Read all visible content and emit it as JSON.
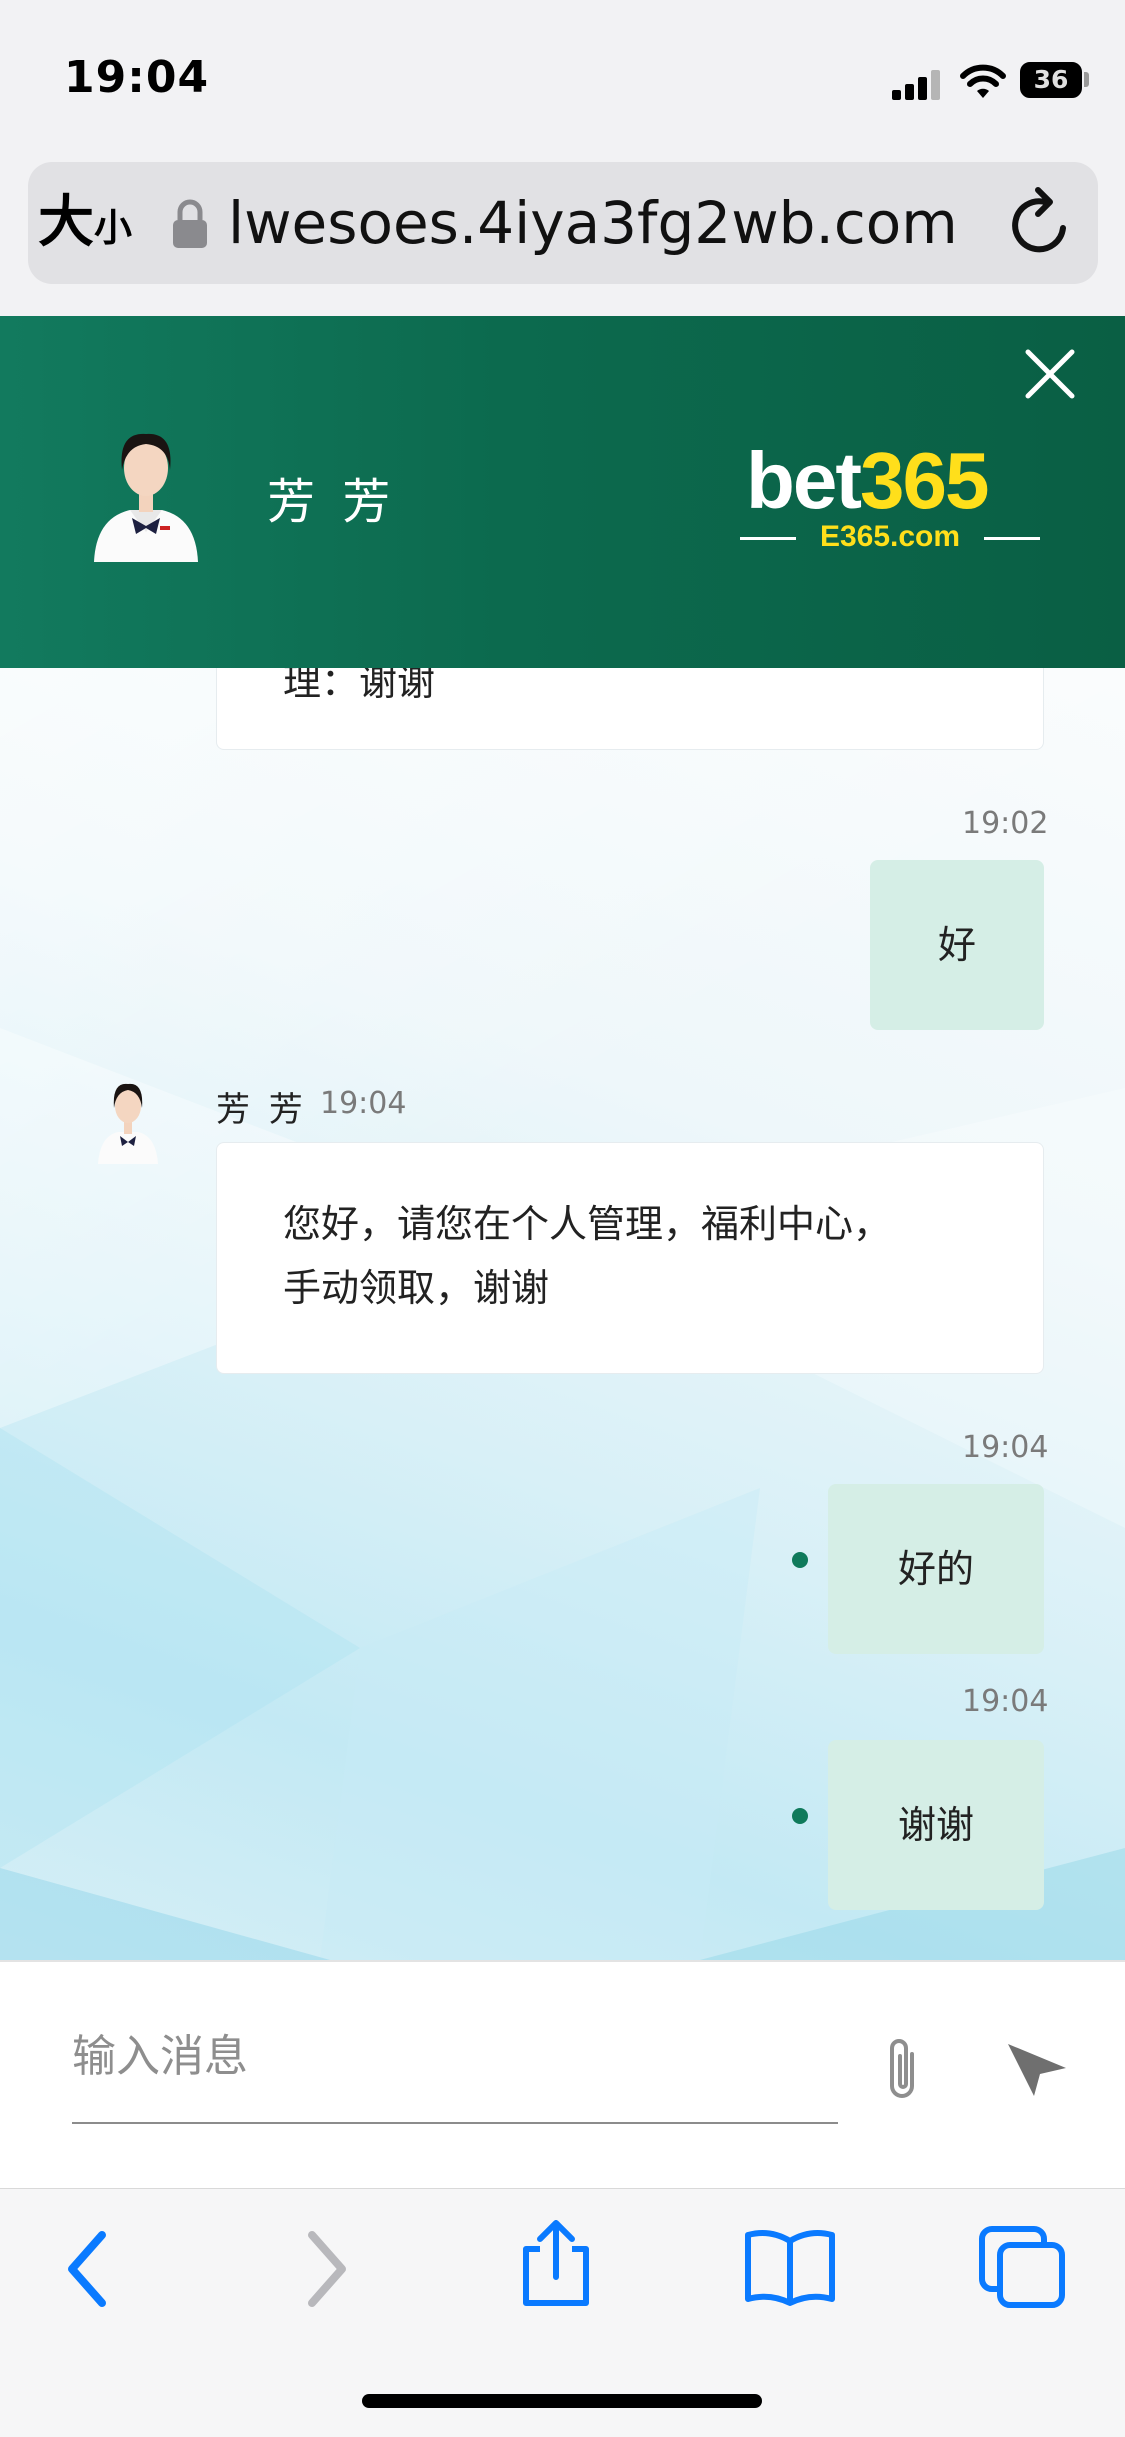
{
  "status_bar": {
    "time": "19:04",
    "battery": "36"
  },
  "address_bar": {
    "text_size_button": "大",
    "text_size_button_small": "小",
    "url": "lwesoes.4iya3fg2wb.com"
  },
  "chat_header": {
    "agent_name": "芳 芳",
    "brand": {
      "name_part1": "bet",
      "name_part2": "365",
      "domain": "E365.com",
      "accent_color": "#ffdf1b"
    },
    "background_color": "#0c6a4e"
  },
  "messages": [
    {
      "direction": "incoming",
      "text": "理：谢谢",
      "partially_visible": true
    },
    {
      "direction": "outgoing",
      "time": "19:02",
      "text": "好"
    },
    {
      "direction": "incoming",
      "sender": "芳 芳",
      "time": "19:04",
      "line1": "您好，请您在个人管理，福利中心，",
      "line2": "手动领取，谢谢"
    },
    {
      "direction": "outgoing",
      "time": "19:04",
      "text": "好的",
      "status": "sent"
    },
    {
      "direction": "outgoing",
      "time": "19:04",
      "text": "谢谢",
      "status": "sent"
    }
  ],
  "composer": {
    "placeholder": "输入消息",
    "value": ""
  },
  "toolbar": {
    "back": "chevron-left-icon",
    "forward": "chevron-right-icon",
    "share": "share-icon",
    "bookmarks": "book-icon",
    "tabs": "tabs-icon",
    "accent_color": "#0a7aff"
  }
}
